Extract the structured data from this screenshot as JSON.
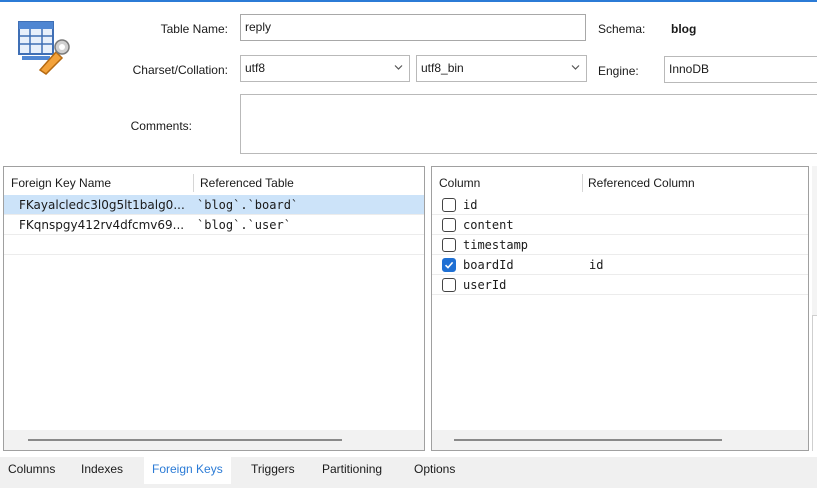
{
  "header": {
    "table_name_label": "Table Name:",
    "table_name_value": "reply",
    "schema_label": "Schema:",
    "schema_value": "blog",
    "charset_label": "Charset/Collation:",
    "charset_value": "utf8",
    "collation_value": "utf8_bin",
    "engine_label": "Engine:",
    "engine_value": "InnoDB",
    "comments_label": "Comments:"
  },
  "foreign_keys": {
    "columns": [
      "Foreign Key Name",
      "Referenced Table"
    ],
    "rows": [
      {
        "name": "FKayalcledc3l0g5lt1balg0...",
        "table": "`blog`.`board`",
        "selected": true
      },
      {
        "name": "FKqnspgy412rv4dfcmv69...",
        "table": "`blog`.`user`",
        "selected": false
      }
    ]
  },
  "fk_columns": {
    "columns": [
      "Column",
      "Referenced Column"
    ],
    "rows": [
      {
        "name": "id",
        "checked": false,
        "ref": ""
      },
      {
        "name": "content",
        "checked": false,
        "ref": ""
      },
      {
        "name": "timestamp",
        "checked": false,
        "ref": ""
      },
      {
        "name": "boardId",
        "checked": true,
        "ref": "id"
      },
      {
        "name": "userId",
        "checked": false,
        "ref": ""
      }
    ]
  },
  "tabs": [
    {
      "label": "Columns",
      "active": false
    },
    {
      "label": "Indexes",
      "active": false
    },
    {
      "label": "Foreign Keys",
      "active": true
    },
    {
      "label": "Triggers",
      "active": false
    },
    {
      "label": "Partitioning",
      "active": false
    },
    {
      "label": "Options",
      "active": false
    }
  ],
  "colors": {
    "accent": "#2b7bd6",
    "selection": "#cce3f9",
    "checkbox": "#1f70d4"
  },
  "icons": {
    "table": "table-edit-icon",
    "dropdown": "chevron-down-icon",
    "check": "checkmark-icon"
  }
}
